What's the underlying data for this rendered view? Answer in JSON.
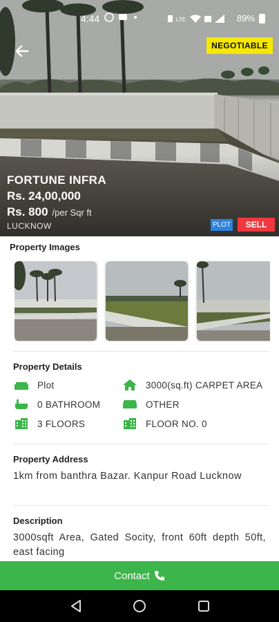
{
  "status_bar": {
    "time": "4:44",
    "left_icons": "◐ ▭ •",
    "battery": "89%"
  },
  "hero": {
    "badge": "NEGOTIABLE",
    "name": "FORTUNE INFRA",
    "price": "Rs. 24,00,000",
    "rate": "Rs. 800",
    "rate_unit": "/per Sqr ft",
    "city": "LUCKNOW",
    "type_tag": "PLOT",
    "deal_tag": "SELL"
  },
  "images": {
    "title": "Property Images"
  },
  "details": {
    "title": "Property Details",
    "items": [
      {
        "icon": "sofa-icon",
        "label": "Plot"
      },
      {
        "icon": "home-icon",
        "label": "3000(sq.ft) CARPET AREA"
      },
      {
        "icon": "bathtub-icon",
        "label": "0 BATHROOM"
      },
      {
        "icon": "sofa-icon",
        "label": "OTHER"
      },
      {
        "icon": "building-icon",
        "label": "3 FLOORS"
      },
      {
        "icon": "building-icon",
        "label": "FLOOR NO. 0"
      }
    ]
  },
  "address": {
    "title": "Property Address",
    "text": "1km from banthra Bazar. Kanpur Road Lucknow"
  },
  "description": {
    "title": "Description",
    "text": "3000sqft Area, Gated Socity, front 60ft depth 50ft, east facing"
  },
  "contact": {
    "label": "Contact"
  },
  "colors": {
    "accent_green": "#3cb54a",
    "badge_yellow": "#f6e800",
    "tag_blue": "#2a83e0",
    "tag_red": "#f0383e"
  }
}
